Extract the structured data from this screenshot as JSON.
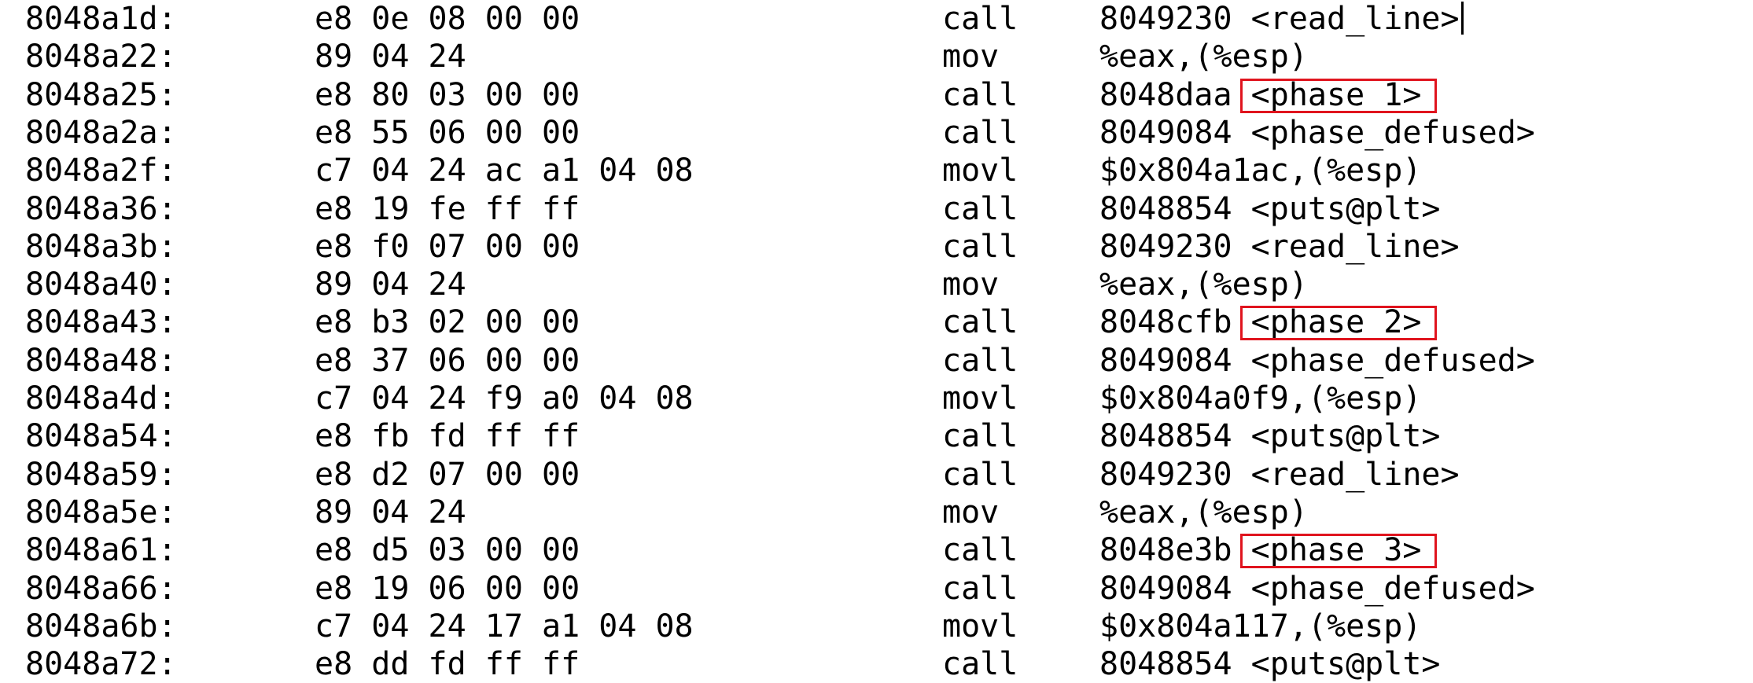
{
  "highlight_color": "#e0141e",
  "lines": [
    {
      "addr": "8048a1d:",
      "bytes": "e8 0e 08 00 00",
      "mnem": "call",
      "ops": "8049230 <read_line>"
    },
    {
      "addr": "8048a22:",
      "bytes": "89 04 24",
      "mnem": "mov",
      "ops": "%eax,(%esp)"
    },
    {
      "addr": "8048a25:",
      "bytes": "e8 80 03 00 00",
      "mnem": "call",
      "ops": "8048daa <phase_1>",
      "highlight": "<phase_1>"
    },
    {
      "addr": "8048a2a:",
      "bytes": "e8 55 06 00 00",
      "mnem": "call",
      "ops": "8049084 <phase_defused>"
    },
    {
      "addr": "8048a2f:",
      "bytes": "c7 04 24 ac a1 04 08",
      "mnem": "movl",
      "ops": "$0x804a1ac,(%esp)"
    },
    {
      "addr": "8048a36:",
      "bytes": "e8 19 fe ff ff",
      "mnem": "call",
      "ops": "8048854 <puts@plt>"
    },
    {
      "addr": "8048a3b:",
      "bytes": "e8 f0 07 00 00",
      "mnem": "call",
      "ops": "8049230 <read_line>"
    },
    {
      "addr": "8048a40:",
      "bytes": "89 04 24",
      "mnem": "mov",
      "ops": "%eax,(%esp)"
    },
    {
      "addr": "8048a43:",
      "bytes": "e8 b3 02 00 00",
      "mnem": "call",
      "ops": "8048cfb <phase_2>",
      "highlight": "<phase_2>"
    },
    {
      "addr": "8048a48:",
      "bytes": "e8 37 06 00 00",
      "mnem": "call",
      "ops": "8049084 <phase_defused>"
    },
    {
      "addr": "8048a4d:",
      "bytes": "c7 04 24 f9 a0 04 08",
      "mnem": "movl",
      "ops": "$0x804a0f9,(%esp)"
    },
    {
      "addr": "8048a54:",
      "bytes": "e8 fb fd ff ff",
      "mnem": "call",
      "ops": "8048854 <puts@plt>"
    },
    {
      "addr": "8048a59:",
      "bytes": "e8 d2 07 00 00",
      "mnem": "call",
      "ops": "8049230 <read_line>"
    },
    {
      "addr": "8048a5e:",
      "bytes": "89 04 24",
      "mnem": "mov",
      "ops": "%eax,(%esp)"
    },
    {
      "addr": "8048a61:",
      "bytes": "e8 d5 03 00 00",
      "mnem": "call",
      "ops": "8048e3b <phase_3>",
      "highlight": "<phase_3>"
    },
    {
      "addr": "8048a66:",
      "bytes": "e8 19 06 00 00",
      "mnem": "call",
      "ops": "8049084 <phase_defused>"
    },
    {
      "addr": "8048a6b:",
      "bytes": "c7 04 24 17 a1 04 08",
      "mnem": "movl",
      "ops": "$0x804a117,(%esp)"
    },
    {
      "addr": "8048a72:",
      "bytes": "e8 dd fd ff ff",
      "mnem": "call",
      "ops": "8048854 <puts@plt>"
    }
  ]
}
